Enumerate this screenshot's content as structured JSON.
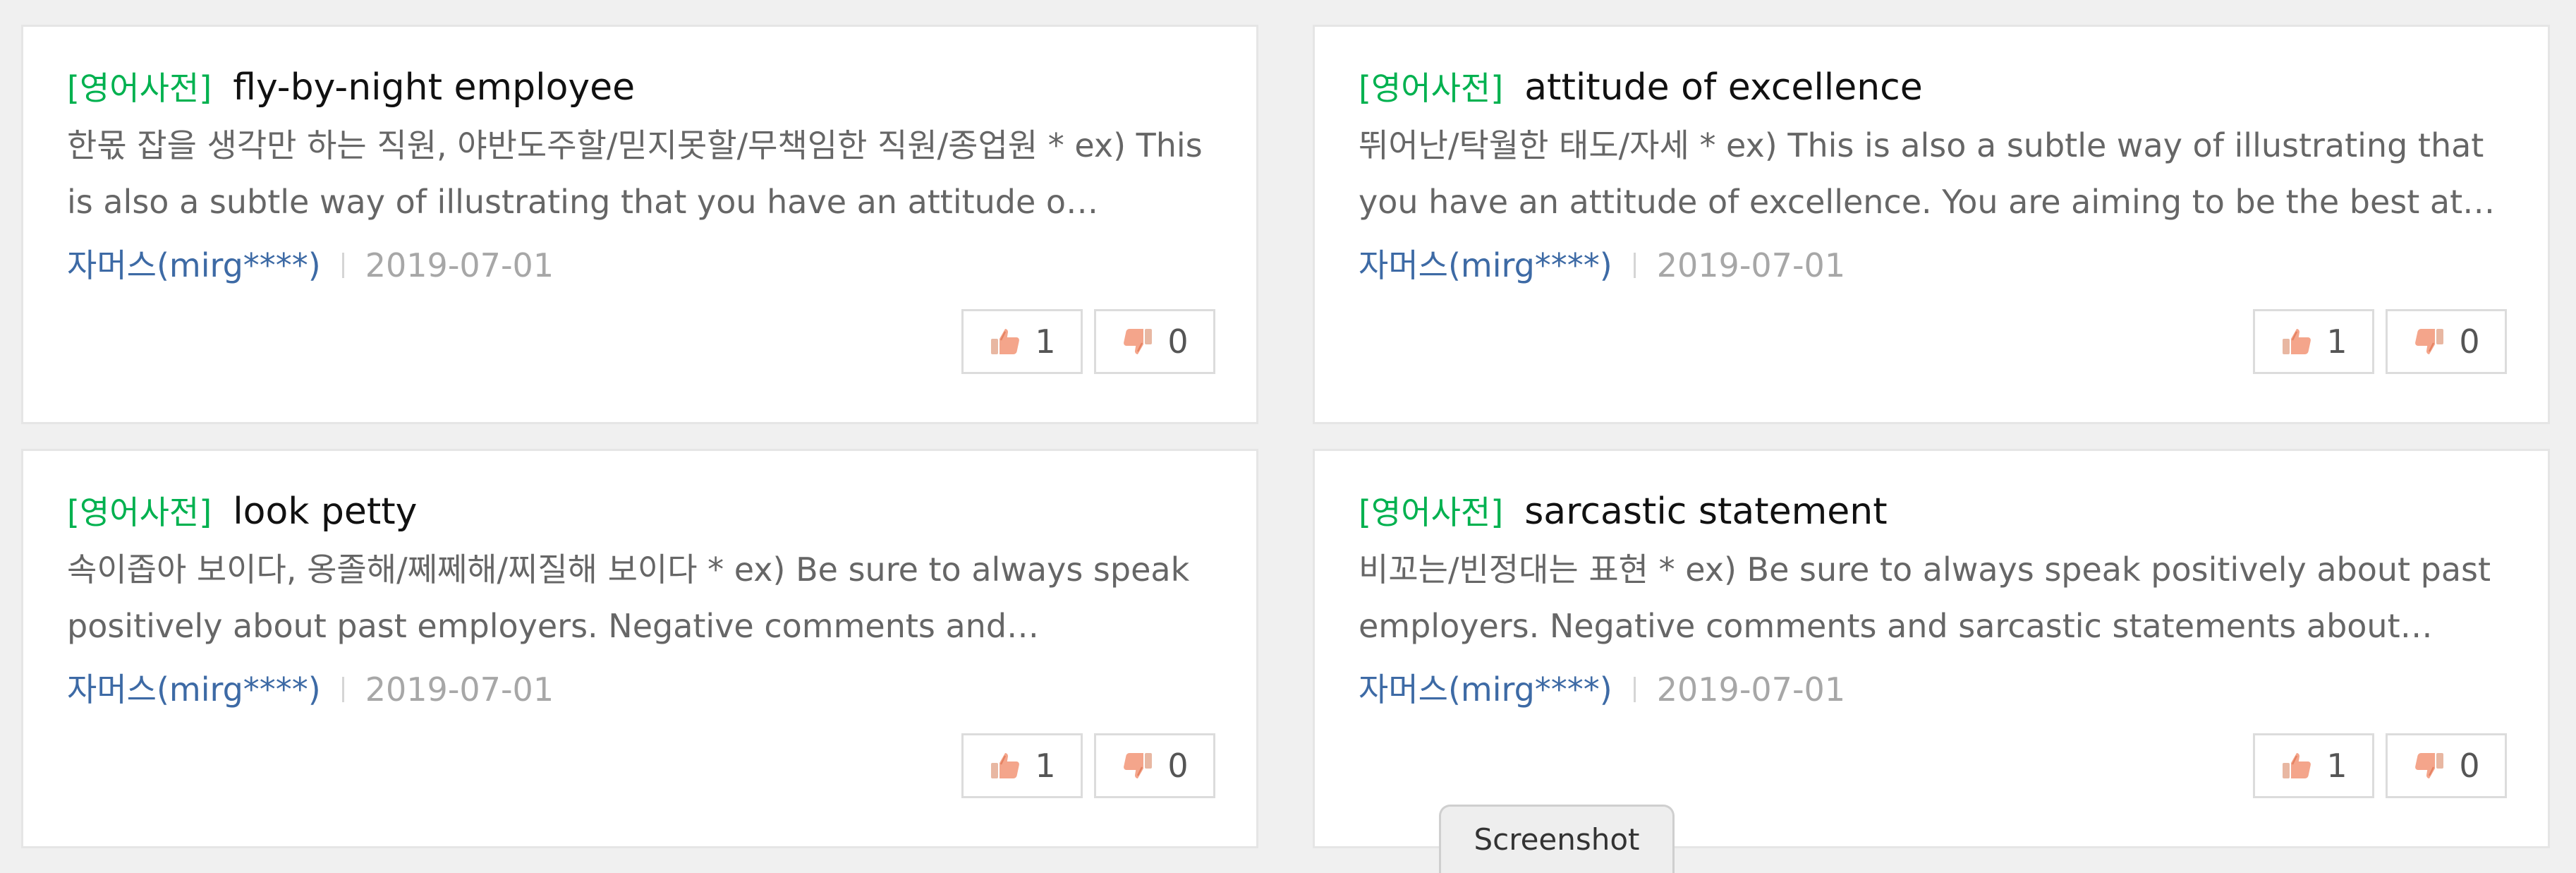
{
  "cards": [
    {
      "tag": "[영어사전]",
      "term": "fly-by-night employee",
      "meaning": "한몫 잡을 생각만 하는 직원, 야반도주할/믿지못할/무책임한 직원/종업원 * ex) This is also a subtle way of illustrating that you have an attitude o…",
      "author": "자머스(mirg****)",
      "date": "2019-07-01",
      "likes": "1",
      "dislikes": "0"
    },
    {
      "tag": "[영어사전]",
      "term": "attitude of excellence",
      "meaning": "뛰어난/탁월한 태도/자세 * ex) This is also a subtle way of illustrating that you have an attitude of excellence. You are aiming to be the best at…",
      "author": "자머스(mirg****)",
      "date": "2019-07-01",
      "likes": "1",
      "dislikes": "0"
    },
    {
      "tag": "[영어사전]",
      "term": "look petty",
      "meaning": "속이좁아 보이다, 옹졸해/쩨쩨해/찌질해 보이다 * ex) Be sure to always speak positively about past employers. Negative comments and…",
      "author": "자머스(mirg****)",
      "date": "2019-07-01",
      "likes": "1",
      "dislikes": "0"
    },
    {
      "tag": "[영어사전]",
      "term": "sarcastic statement",
      "meaning": "비꼬는/빈정대는 표현 * ex) Be sure to always speak positively about past employers. Negative comments and sarcastic statements about…",
      "author": "자머스(mirg****)",
      "date": "2019-07-01",
      "likes": "1",
      "dislikes": "0"
    }
  ],
  "tooltip": "Screenshot",
  "icons": {
    "like": "thumbs-up-icon",
    "dislike": "thumbs-down-icon"
  },
  "colors": {
    "tag": "#00b14f",
    "author": "#3d6aa5",
    "date": "#a7a7a7"
  }
}
